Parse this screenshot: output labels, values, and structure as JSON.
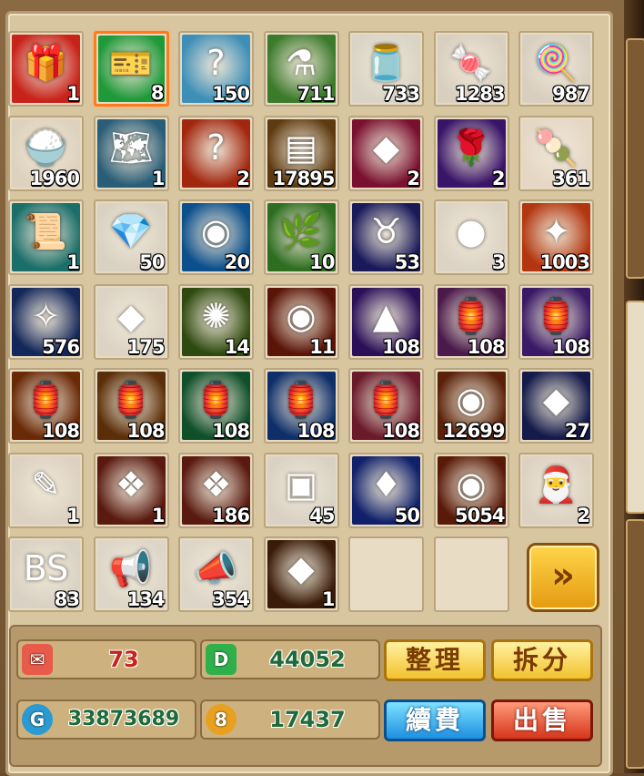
{
  "inventory": {
    "slots": [
      {
        "icon": "gift-box-icon",
        "count": "1",
        "color": "#c8231a",
        "glyph": "🎁"
      },
      {
        "icon": "green-ticket-icon",
        "count": "8",
        "color": "#1f9a3a",
        "glyph": "🎫",
        "selected": true
      },
      {
        "icon": "mystery-card-icon",
        "count": "150",
        "color": "#3e8fb8",
        "glyph": "?"
      },
      {
        "icon": "potion-bottle-icon",
        "count": "711",
        "color": "#3c7a2c",
        "glyph": "⚗"
      },
      {
        "icon": "leaf-jar-icon",
        "count": "733",
        "color": "#d9d4c6",
        "glyph": "🫙"
      },
      {
        "icon": "candy-jar-icon",
        "count": "1283",
        "color": "#d9cfc0",
        "glyph": "🍬"
      },
      {
        "icon": "candy-bowl-icon",
        "count": "987",
        "color": "#d9cfc0",
        "glyph": "🍭"
      },
      {
        "icon": "food-plate-icon",
        "count": "1960",
        "color": "#ddd2be",
        "glyph": "🍚"
      },
      {
        "icon": "treasure-map-icon",
        "count": "1",
        "color": "#2a5e78",
        "glyph": "🗺"
      },
      {
        "icon": "question-card-icon",
        "count": "2",
        "color": "#a2270f",
        "glyph": "?"
      },
      {
        "icon": "gold-bars-icon",
        "count": "17895",
        "color": "#5e3a10",
        "glyph": "▤"
      },
      {
        "icon": "crystal-cube-icon",
        "count": "2",
        "color": "#7a1030",
        "glyph": "◆"
      },
      {
        "icon": "purple-rose-icon",
        "count": "2",
        "color": "#3a1468",
        "glyph": "🌹"
      },
      {
        "icon": "popsicle-icon",
        "count": "361",
        "color": "#e6d7c5",
        "glyph": "🍡"
      },
      {
        "icon": "green-scroll-icon",
        "count": "1",
        "color": "#1b6f6a",
        "glyph": "📜"
      },
      {
        "icon": "blue-gem-icon",
        "count": "50",
        "color": "#d9d2c2",
        "glyph": "💎"
      },
      {
        "icon": "water-orb-icon",
        "count": "20",
        "color": "#0b4f8c",
        "glyph": "◉"
      },
      {
        "icon": "green-leaf-icon",
        "count": "10",
        "color": "#2e6e20",
        "glyph": "🌿"
      },
      {
        "icon": "zodiac-potion-icon",
        "count": "53",
        "color": "#1a1a5a",
        "glyph": "♉"
      },
      {
        "icon": "purple-orb-icon",
        "count": "3",
        "color": "#dcd3c4",
        "glyph": "●"
      },
      {
        "icon": "star-burst-icon",
        "count": "1003",
        "color": "#b2360f",
        "glyph": "✦"
      },
      {
        "icon": "sword-shard-icon",
        "count": "576",
        "color": "#14275a",
        "glyph": "✧"
      },
      {
        "icon": "green-crystal-icon",
        "count": "175",
        "color": "#dcd3c4",
        "glyph": "◆"
      },
      {
        "icon": "green-aura-icon",
        "count": "14",
        "color": "#2f4a10",
        "glyph": "✺"
      },
      {
        "icon": "fire-orb-icon",
        "count": "11",
        "color": "#5a1508",
        "glyph": "◉"
      },
      {
        "icon": "purple-crystal-icon",
        "count": "108",
        "color": "#2b1058",
        "glyph": "▲"
      },
      {
        "icon": "red-lantern-icon",
        "count": "108",
        "color": "#4a1a4a",
        "glyph": "🏮"
      },
      {
        "icon": "purple-lantern-icon",
        "count": "108",
        "color": "#3a1a66",
        "glyph": "🏮"
      },
      {
        "icon": "orange-lantern-icon",
        "count": "108",
        "color": "#6a2a08",
        "glyph": "🏮"
      },
      {
        "icon": "gold-lantern-icon",
        "count": "108",
        "color": "#5a2e08",
        "glyph": "🏮"
      },
      {
        "icon": "green-lantern-icon",
        "count": "108",
        "color": "#0f4f2a",
        "glyph": "🏮"
      },
      {
        "icon": "blue-lantern-icon",
        "count": "108",
        "color": "#0f2f6a",
        "glyph": "🏮"
      },
      {
        "icon": "pink-lantern-icon",
        "count": "108",
        "color": "#6a1a2a",
        "glyph": "🏮"
      },
      {
        "icon": "gold-orb-icon",
        "count": "12699",
        "color": "#5a2008",
        "glyph": "◉"
      },
      {
        "icon": "blue-shard-icon",
        "count": "27",
        "color": "#141a4a",
        "glyph": "◆"
      },
      {
        "icon": "exp-scroll-icon",
        "count": "1",
        "color": "#ddd2c2",
        "glyph": "✎"
      },
      {
        "icon": "orange-crystals-icon",
        "count": "1",
        "color": "#5a1a10",
        "glyph": "❖"
      },
      {
        "icon": "orange-crystals-icon",
        "count": "186",
        "color": "#5a1a10",
        "glyph": "❖"
      },
      {
        "icon": "silver-chest-icon",
        "count": "45",
        "color": "#d9d2c4",
        "glyph": "▣"
      },
      {
        "icon": "blue-diamond-icon",
        "count": "50",
        "color": "#10206a",
        "glyph": "♦"
      },
      {
        "icon": "red-stone-icon",
        "count": "5054",
        "color": "#5a1a08",
        "glyph": "◉"
      },
      {
        "icon": "santa-wreath-icon",
        "count": "2",
        "color": "#ddd2c2",
        "glyph": "🎅"
      },
      {
        "icon": "bs-bag-icon",
        "count": "83",
        "color": "#d9d2c4",
        "glyph": "BS"
      },
      {
        "icon": "silver-megaphone-icon",
        "count": "134",
        "color": "#ddd6c8",
        "glyph": "📢"
      },
      {
        "icon": "purple-megaphone-icon",
        "count": "354",
        "color": "#ddd6c8",
        "glyph": "📣"
      },
      {
        "icon": "amber-crystal-icon",
        "count": "1",
        "color": "#3a1a08",
        "glyph": "◆"
      },
      {
        "icon": "empty-slot",
        "count": "",
        "color": "#e8dcc4",
        "glyph": ""
      },
      {
        "icon": "empty-slot",
        "count": "",
        "color": "#e8dcc4",
        "glyph": ""
      }
    ],
    "next_page_glyph": "»"
  },
  "currency": {
    "ticket": {
      "icon": "ticket-currency-icon",
      "value": "73",
      "color": "#c8231a"
    },
    "cash": {
      "icon": "green-cash-icon",
      "value": "44052",
      "color": "#1e6a3a"
    },
    "gold": {
      "icon": "gold-coin-icon",
      "value": "33873689",
      "color": "#1e6a3a"
    },
    "medal": {
      "icon": "medal-icon",
      "value": "17437",
      "color": "#1e6a3a"
    }
  },
  "buttons": {
    "sort": "整理",
    "split": "拆分",
    "renew": "續費",
    "sell": "出售"
  }
}
